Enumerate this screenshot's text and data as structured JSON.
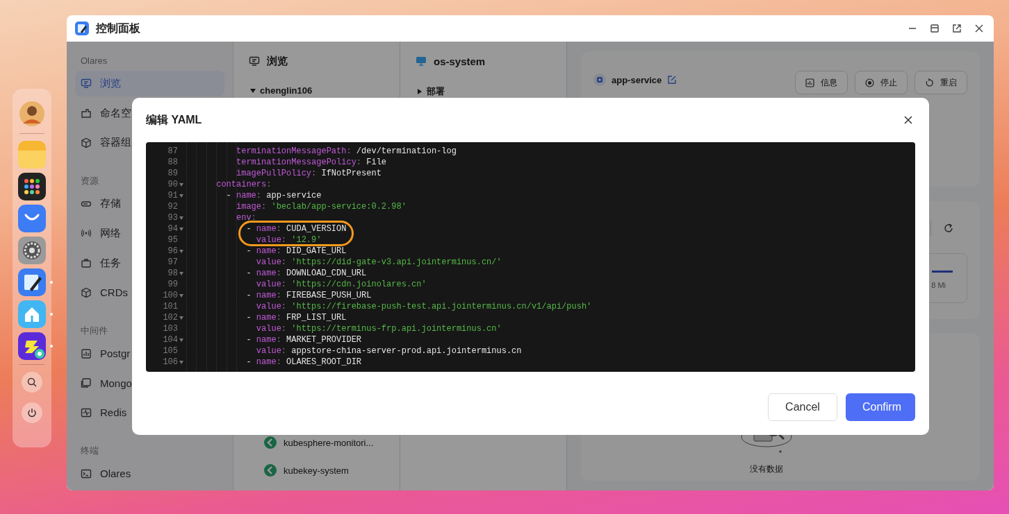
{
  "window": {
    "title": "控制面板"
  },
  "dock": {
    "apps": [
      {
        "kind": "avatar",
        "running": false
      },
      {
        "kind": "files",
        "running": false
      },
      {
        "kind": "launcher",
        "running": false
      },
      {
        "kind": "market",
        "running": false
      },
      {
        "kind": "settings",
        "running": false
      },
      {
        "kind": "control-panel",
        "running": true
      },
      {
        "kind": "home",
        "running": true
      },
      {
        "kind": "studio",
        "running": true
      }
    ]
  },
  "sidebar": {
    "sections": [
      {
        "heading": "Olares",
        "items": [
          {
            "label": "浏览",
            "selected": true
          },
          {
            "label": "命名空",
            "selected": false
          },
          {
            "label": "容器组",
            "selected": false
          }
        ]
      },
      {
        "heading": "资源",
        "items": [
          {
            "label": "存储",
            "selected": false
          },
          {
            "label": "网络",
            "selected": false
          },
          {
            "label": "任务",
            "selected": false
          },
          {
            "label": "CRDs",
            "selected": false
          }
        ]
      },
      {
        "heading": "中间件",
        "items": [
          {
            "label": "Postgr",
            "selected": false
          },
          {
            "label": "Mongo",
            "selected": false
          },
          {
            "label": "Redis",
            "selected": false
          }
        ]
      },
      {
        "heading": "终端",
        "items": [
          {
            "label": "Olares",
            "selected": false
          }
        ]
      }
    ]
  },
  "browse_column": {
    "title": "浏览",
    "tree": [
      {
        "label": "chenglin106",
        "expanded": true,
        "children": [
          {
            "label": "kubesphere-monitori..."
          },
          {
            "label": "kubekey-system"
          }
        ]
      }
    ]
  },
  "namespace_column": {
    "title": "os-system",
    "tree": [
      {
        "label": "部署",
        "expanded": false
      }
    ]
  },
  "detail": {
    "name": "app-service",
    "actions": [
      {
        "label": "信息"
      },
      {
        "label": "停止"
      },
      {
        "label": "重启"
      }
    ],
    "metric": {
      "reading": "8 Mi"
    },
    "empty_text": "没有数据"
  },
  "modal": {
    "title": "编辑 YAML",
    "lines": [
      {
        "number": "87",
        "foldable": false,
        "circled": false,
        "code": "          terminationMessagePath: /dev/termination-log"
      },
      {
        "number": "88",
        "foldable": false,
        "circled": false,
        "code": "          terminationMessagePolicy: File"
      },
      {
        "number": "89",
        "foldable": false,
        "circled": false,
        "code": "          imagePullPolicy: IfNotPresent"
      },
      {
        "number": "90",
        "foldable": true,
        "circled": false,
        "code": "      containers:"
      },
      {
        "number": "91",
        "foldable": true,
        "circled": false,
        "code": "        - name: app-service"
      },
      {
        "number": "92",
        "foldable": false,
        "circled": false,
        "code": "          image: 'beclab/app-service:0.2.98'"
      },
      {
        "number": "93",
        "foldable": true,
        "circled": false,
        "code": "          env:"
      },
      {
        "number": "94",
        "foldable": true,
        "circled": true,
        "code": "            - name: CUDA_VERSION"
      },
      {
        "number": "95",
        "foldable": false,
        "circled": true,
        "code": "              value: '12.9'"
      },
      {
        "number": "96",
        "foldable": true,
        "circled": false,
        "code": "            - name: DID_GATE_URL"
      },
      {
        "number": "97",
        "foldable": false,
        "circled": false,
        "code": "              value: 'https://did-gate-v3.api.jointerminus.cn/'"
      },
      {
        "number": "98",
        "foldable": true,
        "circled": false,
        "code": "            - name: DOWNLOAD_CDN_URL"
      },
      {
        "number": "99",
        "foldable": false,
        "circled": false,
        "code": "              value: 'https://cdn.joinolares.cn'"
      },
      {
        "number": "100",
        "foldable": true,
        "circled": false,
        "code": "            - name: FIREBASE_PUSH_URL"
      },
      {
        "number": "101",
        "foldable": false,
        "circled": false,
        "code": "              value: 'https://firebase-push-test.api.jointerminus.cn/v1/api/push'"
      },
      {
        "number": "102",
        "foldable": true,
        "circled": false,
        "code": "            - name: FRP_LIST_URL"
      },
      {
        "number": "103",
        "foldable": false,
        "circled": false,
        "code": "              value: 'https://terminus-frp.api.jointerminus.cn'"
      },
      {
        "number": "104",
        "foldable": true,
        "circled": false,
        "code": "            - name: MARKET_PROVIDER"
      },
      {
        "number": "105",
        "foldable": false,
        "circled": false,
        "code": "              value: appstore-china-server-prod.api.jointerminus.cn"
      },
      {
        "number": "106",
        "foldable": true,
        "circled": false,
        "code": "            - name: OLARES_ROOT_DIR"
      }
    ],
    "buttons": [
      {
        "label": "Cancel",
        "kind": "secondary"
      },
      {
        "label": "Confirm",
        "kind": "primary"
      }
    ]
  }
}
